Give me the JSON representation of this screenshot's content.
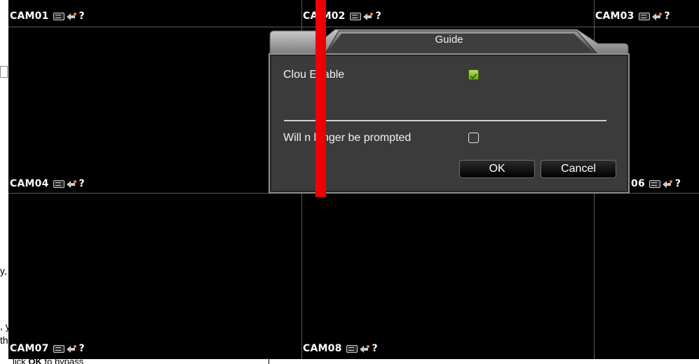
{
  "cameras": {
    "cam01": "CAM01",
    "cam02": "CA M02",
    "cam03": "CAM03",
    "cam04": "CAM04",
    "cam06": "06",
    "cam07": "CAM07",
    "cam08": "CAM08",
    "help_glyph": "?"
  },
  "dialog": {
    "title": "Guide",
    "cloud_label": "Clou  Enable",
    "cloud_checked": true,
    "prompt_label": "Will n  longer be prompted",
    "prompt_checked": false,
    "ok_label": "OK",
    "cancel_label": "Cancel"
  },
  "background_text": {
    "line1": "y,",
    "line2": ", y",
    "line3": "th",
    "line4_prefix": "lick ",
    "line4_bold": "OK",
    "line4_suffix": " to bypass"
  },
  "colors": {
    "grid_background": "#000000",
    "grid_lines": "#5a5a5a",
    "dialog_body": "#3b3b3b",
    "check_green": "#7fc12e",
    "red_bar": "#ee0000"
  },
  "icons": [
    "record-icon",
    "ptz-icon",
    "help-icon",
    "checkbox-checked-icon",
    "checkbox-empty-icon"
  ]
}
